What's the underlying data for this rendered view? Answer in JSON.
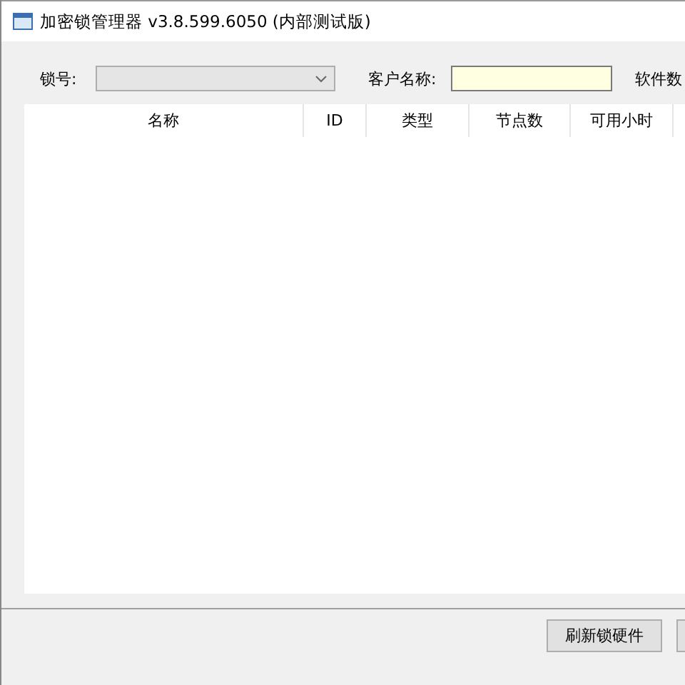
{
  "window": {
    "title": "加密锁管理器 v3.8.599.6050 (内部测试版)"
  },
  "form": {
    "lock_label": "锁号:",
    "customer_label": "客户名称:",
    "software_label": "软件数"
  },
  "table": {
    "columns": [
      "名称",
      "ID",
      "类型",
      "节点数",
      "可用小时"
    ]
  },
  "buttons": [
    "刷新锁硬件"
  ]
}
